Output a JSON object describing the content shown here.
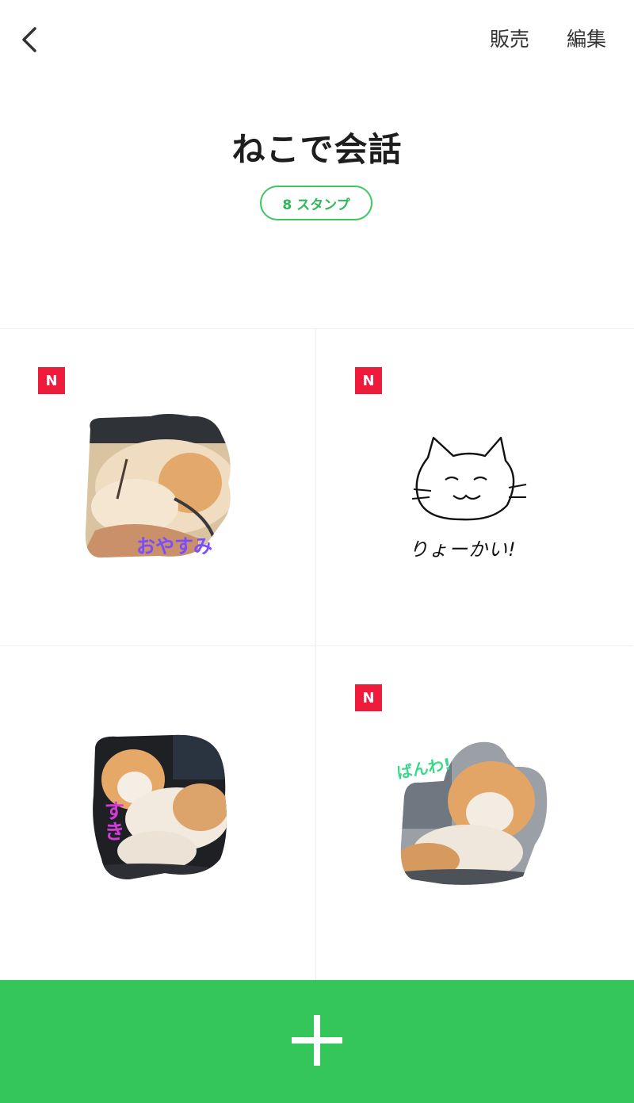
{
  "header": {
    "sell_label": "販売",
    "edit_label": "編集"
  },
  "set": {
    "title": "ねこで会話",
    "count_label": "8 スタンプ"
  },
  "stickers": [
    {
      "new_badge": "N",
      "caption": "おやすみ",
      "caption_color": "#7a4cff"
    },
    {
      "new_badge": "N",
      "caption": "りょーかい!",
      "caption_color": "#111111"
    },
    {
      "new_badge": "",
      "caption": "すき",
      "caption_color": "#d23bd8"
    },
    {
      "new_badge": "N",
      "caption": "ばんわ!",
      "caption_color": "#39d98a"
    }
  ],
  "colors": {
    "accent": "#35c65b",
    "badge": "#ee1c3a"
  },
  "icons": {
    "back": "chevron-left-icon",
    "add": "plus-icon"
  }
}
